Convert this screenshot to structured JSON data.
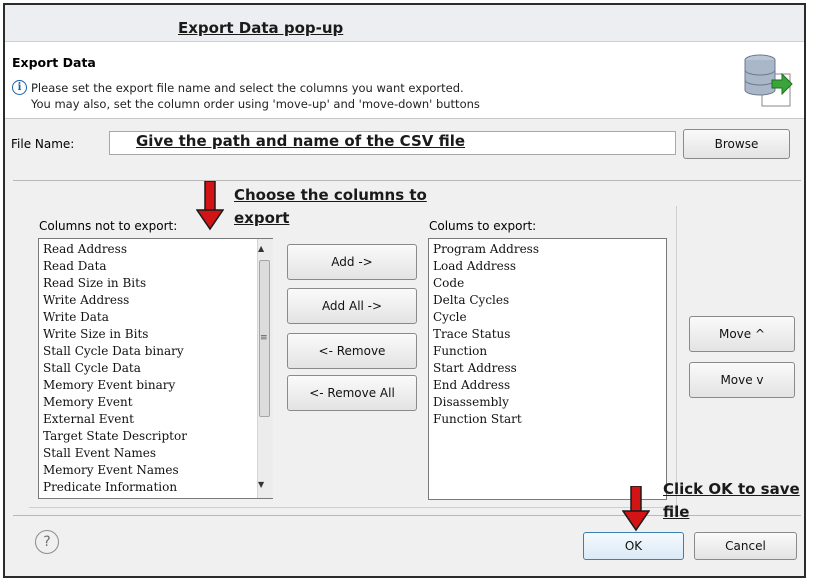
{
  "annotations": {
    "title": "Export Data pop-up",
    "file_hint": "Give the path and name of the CSV file",
    "choose_line1": "Choose the columns to",
    "choose_line2": "export",
    "ok_line1": "Click OK to save",
    "ok_line2": "file"
  },
  "header": {
    "title": "Export Data",
    "info_line1": "Please set the export file name and select the columns you want exported.",
    "info_line2": "You may also, set the column order using 'move-up' and 'move-down' buttons"
  },
  "file": {
    "label": "File Name:",
    "value": "",
    "browse": "Browse"
  },
  "left_list": {
    "label": "Columns not to export:",
    "items": [
      "Read Address",
      "Read Data",
      "Read Size in Bits",
      "Write Address",
      "Write Data",
      "Write Size in Bits",
      "Stall Cycle Data binary",
      "Stall Cycle Data",
      "Memory Event binary",
      "Memory Event",
      "External Event",
      "Target State Descriptor",
      "Stall Event Names",
      "Memory Event Names",
      "Predicate Information"
    ]
  },
  "right_list": {
    "label": "Colums to export:",
    "items": [
      "Program Address",
      "Load Address",
      "Code",
      "Delta Cycles",
      "Cycle",
      "Trace Status",
      "Function",
      "Start Address",
      "End Address",
      "Disassembly",
      "Function Start"
    ]
  },
  "buttons": {
    "add": "Add ->",
    "add_all": "Add All ->",
    "remove": "<- Remove",
    "remove_all": "<- Remove All",
    "move_up": "Move ^",
    "move_down": "Move v",
    "ok": "OK",
    "cancel": "Cancel"
  },
  "colors": {
    "annotation_arrow": "#d21414",
    "ok_border": "#3c7fb1"
  }
}
